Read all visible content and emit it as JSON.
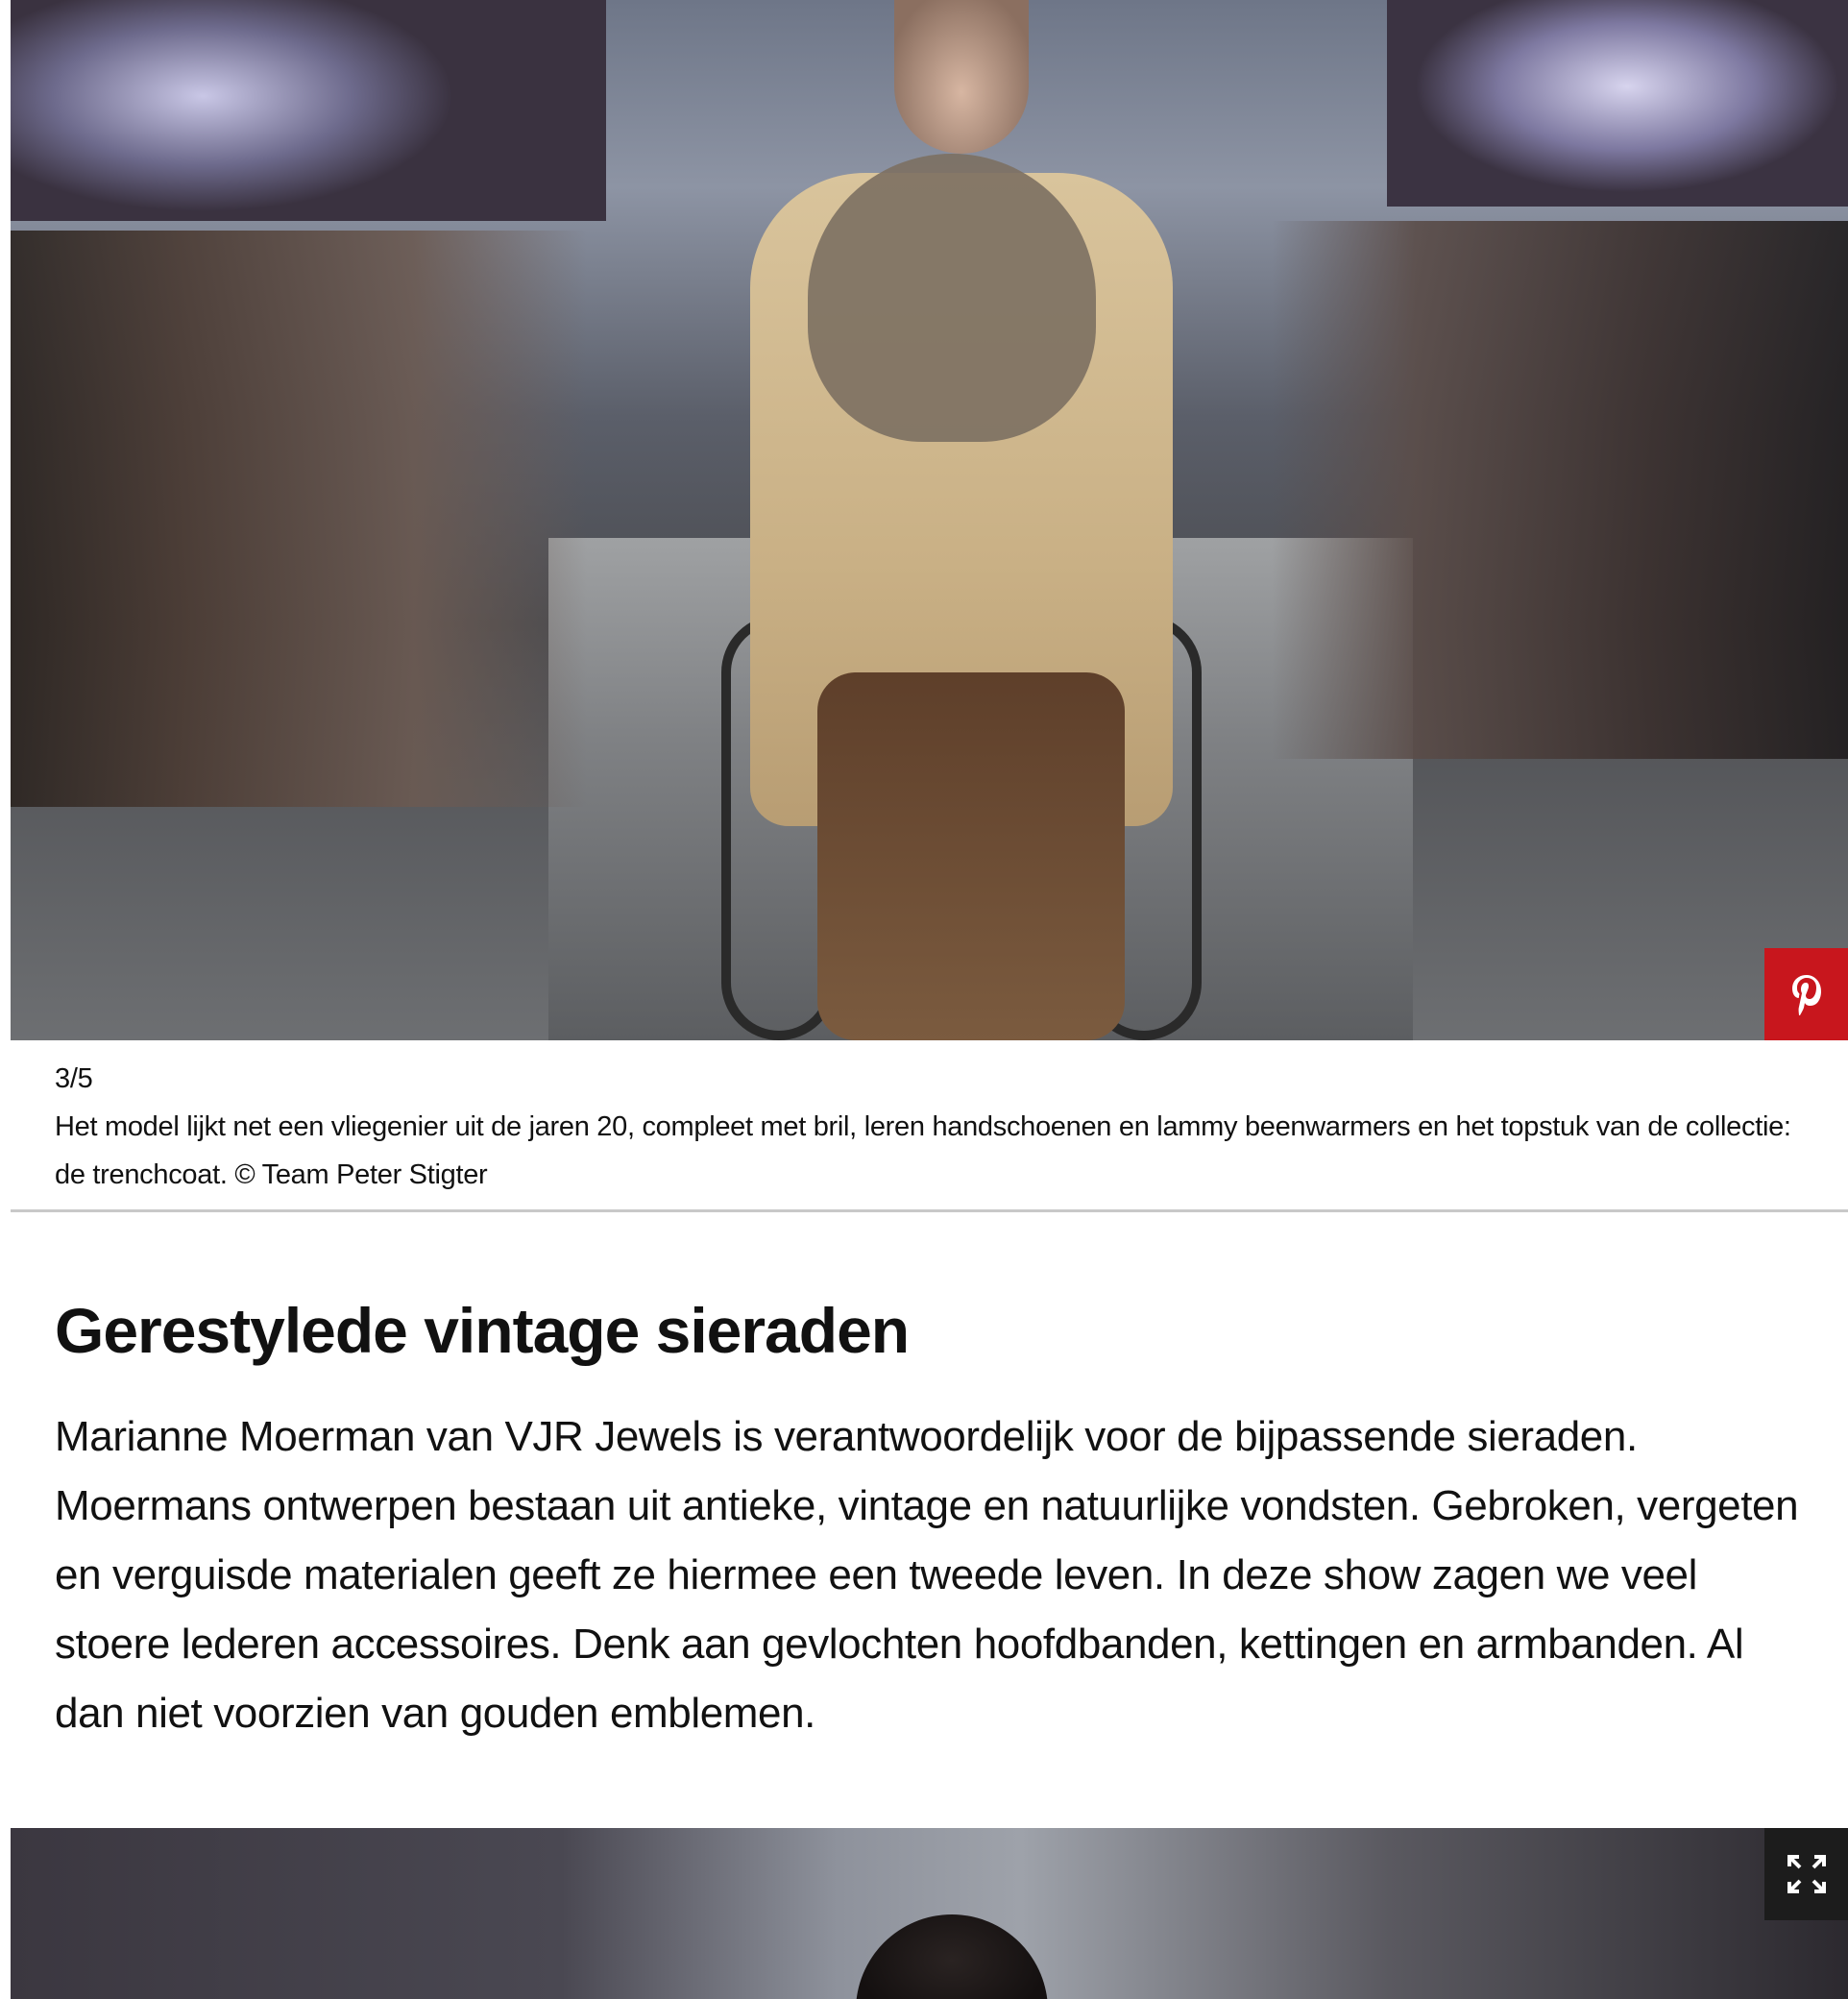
{
  "slide1": {
    "counter": "3/5",
    "caption": "Het model lijkt net een vliegenier uit de jaren 20, compleet met bril, leren handschoenen en lammy beenwarmers en het topstuk van de collectie: de trenchcoat. © Team Peter Stigter",
    "pin_icon": "pinterest-icon"
  },
  "section": {
    "title": "Gerestylede vintage sieraden",
    "body": "Marianne Moerman van VJR Jewels is verantwoordelijk voor de bijpassende sieraden. Moermans ontwerpen bestaan uit antieke, vintage en natuurlijke vondsten. Gebroken, vergeten en verguisde materialen geeft ze hiermee een tweede leven. In deze show zagen we veel stoere lederen accessoires. Denk aan gevlochten hoofdbanden, kettingen en armbanden. Al dan niet voorzien van gouden emblemen."
  },
  "slide2": {
    "expand_icon": "expand-icon"
  },
  "colors": {
    "pinterest": "#c8161d",
    "divider": "#c9c9c9",
    "text": "#111111"
  }
}
